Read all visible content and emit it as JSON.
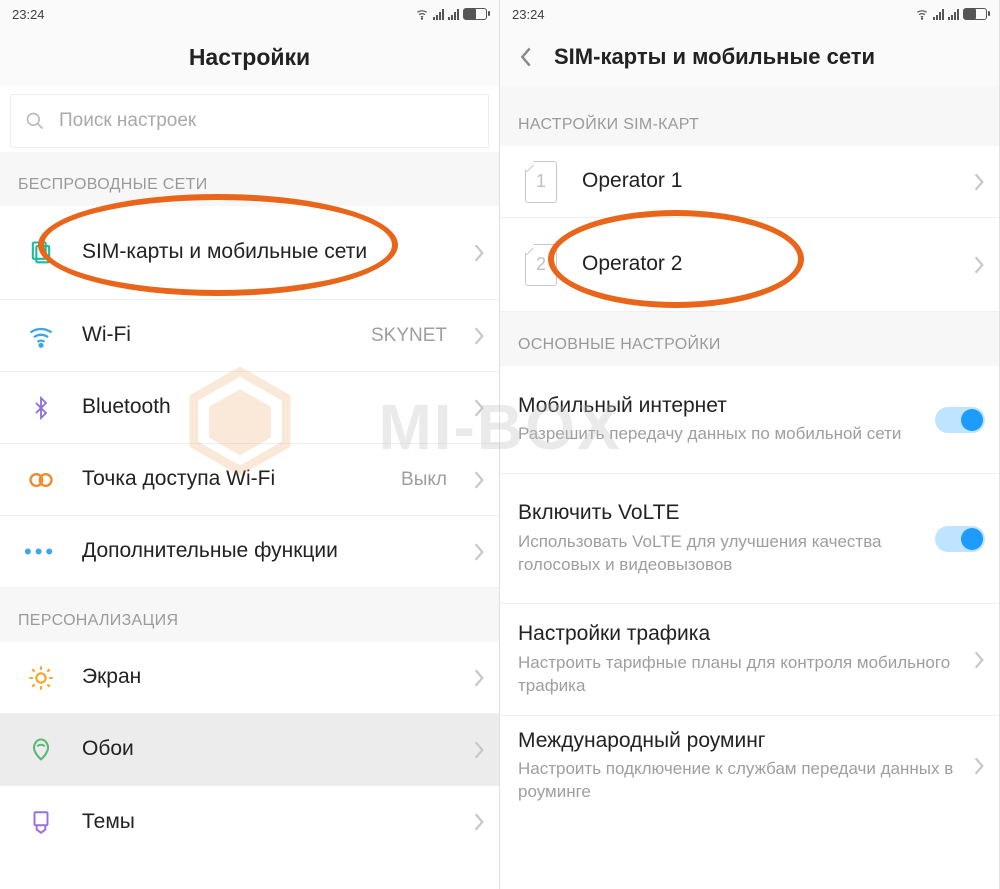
{
  "status": {
    "time": "23:24"
  },
  "watermark": "MI-BOX",
  "left": {
    "title": "Настройки",
    "search_placeholder": "Поиск настроек",
    "sections": {
      "wireless_header": "БЕСПРОВОДНЫЕ СЕТИ",
      "personalization_header": "ПЕРСОНАЛИЗАЦИЯ"
    },
    "items": {
      "sim": "SIM-карты и мобильные сети",
      "wifi": "Wi-Fi",
      "wifi_value": "SKYNET",
      "bt": "Bluetooth",
      "hotspot": "Точка доступа Wi-Fi",
      "hotspot_value": "Выкл",
      "more": "Дополнительные функции",
      "display": "Экран",
      "wallpaper": "Обои",
      "themes": "Темы"
    }
  },
  "right": {
    "title": "SIM-карты и мобильные сети",
    "sections": {
      "sim_header": "НАСТРОЙКИ SIM-КАРТ",
      "main_header": "ОСНОВНЫЕ НАСТРОЙКИ"
    },
    "sim1": {
      "num": "1",
      "label": "Operator 1"
    },
    "sim2": {
      "num": "2",
      "label": "Operator 2"
    },
    "items": {
      "data_title": "Мобильный интернет",
      "data_sub": "Разрешить передачу данных по мобильной сети",
      "volte_title": "Включить VoLTE",
      "volte_sub": "Использовать VoLTE для улучшения качества голосовых и видеовызовов",
      "traffic_title": "Настройки трафика",
      "traffic_sub": "Настроить тарифные планы для контроля мобильного трафика",
      "roaming_title": "Международный роуминг",
      "roaming_sub": "Настроить подключение к службам передачи данных в роуминге"
    }
  }
}
